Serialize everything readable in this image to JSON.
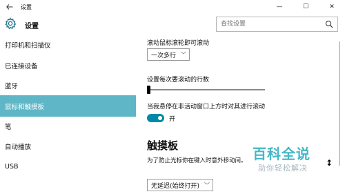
{
  "window": {
    "title": "设置",
    "back_icon": "back-arrow-icon",
    "controls": [
      "—",
      "☐",
      "✕"
    ]
  },
  "header": {
    "title": "设置",
    "icon": "gear-icon",
    "search": {
      "placeholder": "查找设置",
      "icon": "search-icon"
    }
  },
  "sidebar": {
    "items": [
      {
        "label": "打印机和扫描仪",
        "active": false
      },
      {
        "label": "已连接设备",
        "active": false
      },
      {
        "label": "蓝牙",
        "active": false
      },
      {
        "label": "鼠标和触摸板",
        "active": true
      },
      {
        "label": "笔",
        "active": false
      },
      {
        "label": "自动播放",
        "active": false
      },
      {
        "label": "USB",
        "active": false
      }
    ],
    "accent": "#5eb6c6"
  },
  "content": {
    "scroll_label": "滚动鼠标滚轮即可滚动",
    "scroll_dropdown": "一次多行",
    "lines_label": "设置每次要滚动的行数",
    "lines_value": 1,
    "inactive_scroll_label": "当我悬停在非活动窗口上方时对其进行滚动",
    "toggle_state": "开",
    "toggle_on": true,
    "toggle_color": "#008aa6",
    "touchpad_title": "触摸板",
    "touchpad_desc": "为了防止光标你在键入时意外移动间。",
    "delay_dropdown": "无延迟(始终打开)"
  },
  "watermark": {
    "line1": "百科全说",
    "line2": "助你轻松解决"
  }
}
